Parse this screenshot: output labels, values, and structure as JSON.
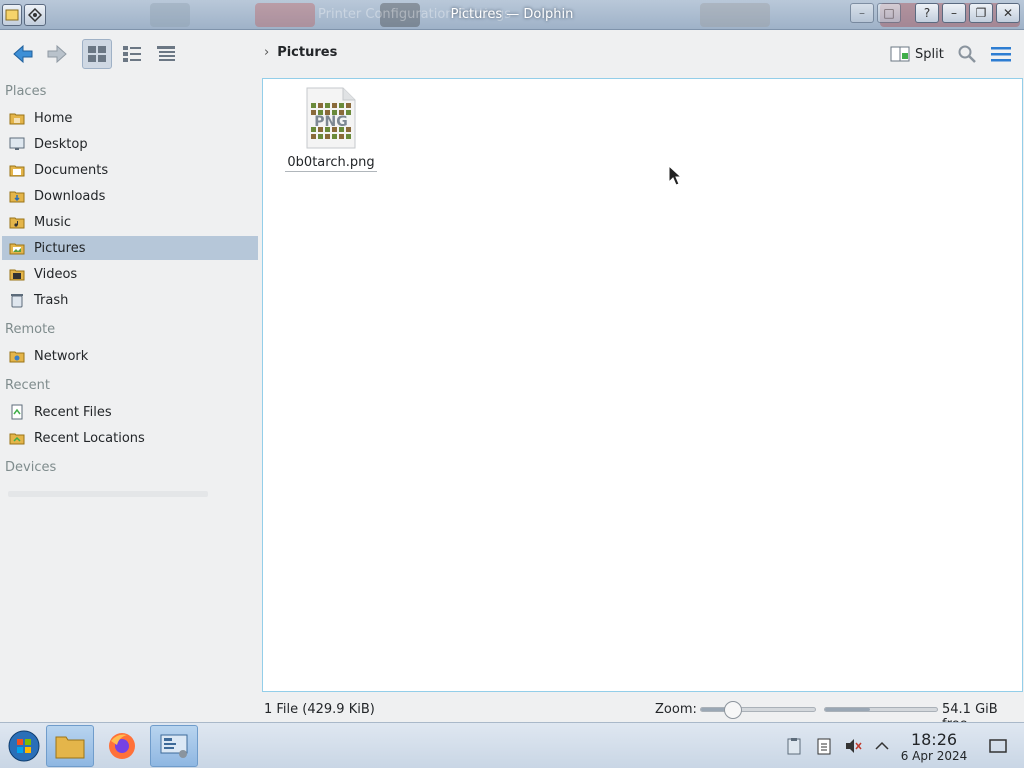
{
  "window": {
    "title": "Pictures — Dolphin",
    "background_ghost_text": "Printer Configuration Settings"
  },
  "toolbar": {
    "back_icon": "arrow-left-icon",
    "forward_icon": "arrow-right-icon",
    "view_modes": [
      "icons-view-icon",
      "compact-view-icon",
      "details-view-icon"
    ],
    "active_view": "icons-view-icon",
    "breadcrumb": [
      "Pictures"
    ],
    "split_label": "Split",
    "search_icon": "search-icon",
    "menu_icon": "hamburger-menu-icon"
  },
  "sidebar": {
    "sections": [
      {
        "label": "Places",
        "items": [
          {
            "label": "Home",
            "icon": "home-folder-icon"
          },
          {
            "label": "Desktop",
            "icon": "desktop-folder-icon"
          },
          {
            "label": "Documents",
            "icon": "documents-folder-icon"
          },
          {
            "label": "Downloads",
            "icon": "downloads-folder-icon"
          },
          {
            "label": "Music",
            "icon": "music-folder-icon"
          },
          {
            "label": "Pictures",
            "icon": "pictures-folder-icon",
            "selected": true
          },
          {
            "label": "Videos",
            "icon": "videos-folder-icon"
          },
          {
            "label": "Trash",
            "icon": "trash-icon"
          }
        ]
      },
      {
        "label": "Remote",
        "items": [
          {
            "label": "Network",
            "icon": "network-folder-icon"
          }
        ]
      },
      {
        "label": "Recent",
        "items": [
          {
            "label": "Recent Files",
            "icon": "recent-files-icon"
          },
          {
            "label": "Recent Locations",
            "icon": "recent-locations-icon"
          }
        ]
      },
      {
        "label": "Devices",
        "items": []
      }
    ]
  },
  "files": [
    {
      "name": "0b0tarch.png",
      "thumb_text": "PNG",
      "icon": "png-file-icon"
    }
  ],
  "status": {
    "summary": "1 File (429.9 KiB)",
    "zoom_label": "Zoom:",
    "zoom_level": 0.28,
    "free_space": "54.1 GiB free",
    "used_fraction": 0.4
  },
  "taskbar": {
    "apps": [
      "start-orb-icon",
      "file-manager-icon",
      "firefox-icon",
      "system-settings-icon"
    ],
    "tray": [
      "clipboard-manager-icon",
      "notes-icon",
      "volume-muted-icon",
      "expand-tray-icon"
    ],
    "time": "18:26",
    "date": "6 Apr 2024",
    "show_desktop_icon": "show-desktop-icon"
  }
}
